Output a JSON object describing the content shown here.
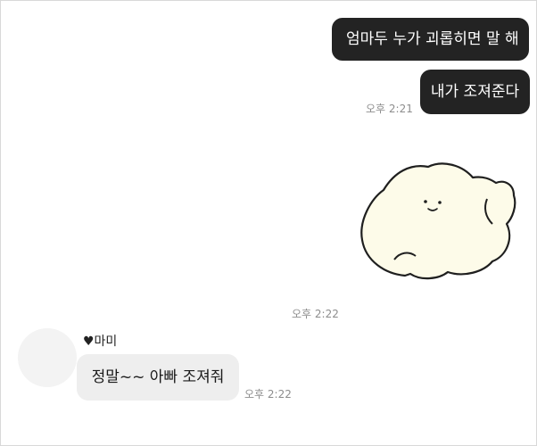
{
  "chat": {
    "outgoing": [
      {
        "text": "엄마두 누가 괴롭히면 말 해"
      },
      {
        "text": "내가 조져준다"
      }
    ],
    "timestamps": {
      "outgoing_text": "오후 2:21",
      "sticker": "오후 2:22",
      "incoming": "오후 2:22"
    },
    "sticker": {
      "icon": "smiling-blob-sticker-icon"
    },
    "incoming": {
      "sender_name": "♥마미",
      "text": "정말~~ 아빠 조져줘",
      "avatar_icon": "avatar-placeholder-icon"
    }
  },
  "colors": {
    "outgoing_bubble": "#232323",
    "incoming_bubble": "#eeeeee",
    "sticker_fill": "#fdfbe9"
  }
}
